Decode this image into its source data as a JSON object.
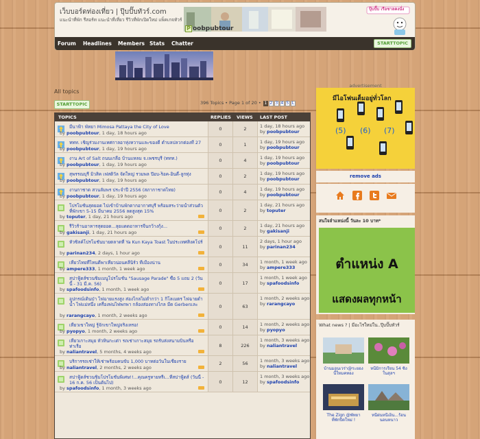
{
  "header": {
    "site_title": "เว็บบอร์ดท่องเที่ยว | ปุ๊บปั๊บทัวร์.com",
    "tagline": "แนะนำที่พัก รีสอร์ท แนะนำที่เที่ยว รีวิวที่พักเปิดใหม่ แพ็คเกจทัวร์",
    "logo_mark": "P",
    "logo_text": "oobpubtour",
    "sticker_text": "ปุ๊บปั๊บ เรือชาลคงนั่ง"
  },
  "nav": {
    "items": [
      "Forum",
      "Headlines",
      "Members",
      "Stats",
      "Chatter"
    ],
    "start_topic_a": "START",
    "start_topic_b": "TOPIC"
  },
  "main": {
    "heading": "All topics",
    "start_topic_a": "START",
    "start_topic_b": "TOPIC",
    "pager_text": "396 Topics • Page 1 of 20 •",
    "pages": [
      "1",
      "2",
      "3",
      "4",
      "5",
      "L"
    ],
    "columns": {
      "topics": "TOPICS",
      "replies": "REPLIES",
      "views": "VIEWS",
      "last_post": "LAST POST"
    },
    "topics": [
      {
        "title": "มีนาฟ้า พัทยา Mimosa Pattaya the City of Love",
        "author": "poobpubtour",
        "age": "1 day, 18 hours ago",
        "replies": "0",
        "views": "2",
        "last_time": "1 day, 18 hours ago",
        "last_by": "poobpubtour",
        "pinned": true,
        "hot": false
      },
      {
        "title": "ททท. เชิญร่วมงานเทศกาลอาหุ่งหวานและของดี ตำบลปลวกต่องที่ 27",
        "author": "poobpubtour",
        "age": "1 day, 19 hours ago",
        "replies": "0",
        "views": "1",
        "last_time": "1 day, 19 hours ago",
        "last_by": "poobpubtour",
        "pinned": true,
        "hot": false
      },
      {
        "title": "งาน Art of Salt ถนนเกลือ บ้านแหลม จ.เพชรบุรี (ททท.)",
        "author": "poobpubtour",
        "age": "1 day, 19 hours ago",
        "replies": "0",
        "views": "4",
        "last_time": "1 day, 19 hours ago",
        "last_by": "poobpubtour",
        "pinned": true,
        "hot": false
      },
      {
        "title": "สุพรรณบุรี มิวสิค เฟสติวัล จัดใหญ่ รวมพล ป๊อบ-ร็อค-อินดี้-ลูกทุ่ง",
        "author": "poobpubtour",
        "age": "1 day, 19 hours ago",
        "replies": "0",
        "views": "2",
        "last_time": "1 day, 19 hours ago",
        "last_by": "poobpubtour",
        "pinned": true,
        "hot": false
      },
      {
        "title": "งานกาชาด สวนลัมพร ประจำปี 2556 (สภากาชาดไทย)",
        "author": "poobpubtour",
        "age": "1 day, 19 hours ago",
        "replies": "0",
        "views": "4",
        "last_time": "1 day, 19 hours ago",
        "last_by": "poobpubtour",
        "pinned": true,
        "hot": false
      },
      {
        "title": "โปรโมชั่นสุดยอด ไปเข้าบ้านพักตากอากาศบุรี พร้อมสระว่ายน้ำส่วนตัว ที่พักเขา 5-15 มีนาคม 2556 ลดสูงสุด 15%",
        "author": "toputer",
        "age": "1 day, 21 hours ago",
        "replies": "0",
        "views": "2",
        "last_time": "1 day, 21 hours ago",
        "last_by": "toputer",
        "pinned": false,
        "hot": true
      },
      {
        "title": "รีวิวร้านอาหารสุดยอด...ลุยแดดอาหารจีนกว้างกุ้ง...",
        "author": "gakisanji",
        "age": "1 day, 21 hours ago",
        "replies": "0",
        "views": "2",
        "last_time": "1 day, 21 hours ago",
        "last_by": "gakisanji",
        "pinned": false,
        "hot": true
      },
      {
        "title": "หัวซิลค์โปรโมชันบายตลาดที่ Ya Kun Kaya Toast ในประเทศสิงคโปร์",
        "author": "parinan234",
        "age": "2 days, 1 hour ago",
        "replies": "0",
        "views": "11",
        "last_time": "2 days, 1 hour ago",
        "last_by": "parinan234",
        "pinned": false,
        "hot": true
      },
      {
        "title": "เที่ยวไทยที่ไหนดีพาเที่ยวน่อนคลีนิร์ว ที่เมืองน่าน",
        "author": "ampere333",
        "age": "1 month, 1 week ago",
        "replies": "0",
        "views": "34",
        "last_time": "1 month, 1 week ago",
        "last_by": "ampere333",
        "pinned": false,
        "hot": true
      },
      {
        "title": "สปาฟู้ดส์ชวนชิมเมนูโปรโมชั่น \"Sausage Parade\" ซื้อ 5 แถม 2 (วันนี้ - 31 มี.ค. 56)",
        "author": "spafoodsinfo",
        "age": "1 month, 1 week ago",
        "replies": "0",
        "views": "17",
        "last_time": "1 month, 1 week ago",
        "last_by": "spafoodsinfo",
        "pinned": false,
        "hot": true
      },
      {
        "title": "อุปกรณ์เดินป่า ไฟฉายแรงสูง ส่องไกลไม่ต่ำกว่า 1 กิโลเมตร ไฟฉายดำน้ำ ไฟแม่หนึ่ง เครื่องพ่นไฟพกพา กล้องส่องทางไกล มีด Gerberและไทยผลกกล้า",
        "author": "rarangcayo",
        "age": "1 month, 2 weeks ago",
        "replies": "0",
        "views": "63",
        "last_time": "1 month, 2 weeks ago",
        "last_by": "rarangcayo",
        "pinned": false,
        "hot": true
      },
      {
        "title": "เที่ยวเขาใหญ่ รู้จักเขาใหญ่จริงเหรอ!",
        "author": "pyopyo",
        "age": "1 month, 2 weeks ago",
        "replies": "0",
        "views": "14",
        "last_time": "1 month, 2 weeks ago",
        "last_by": "pyopyo",
        "pinned": false,
        "hot": true
      },
      {
        "title": "เที่ยวเกาะสมุย หัวหินกะเต่า รถเช่าเกาะสมุย รถรับส่งสนามบินหรือท่าเรือ",
        "author": "naliantravel",
        "age": "5 months, 4 weeks ago",
        "replies": "8",
        "views": "226",
        "last_time": "1 month, 3 weeks ago",
        "last_by": "naliantravel",
        "pinned": false,
        "hot": true
      },
      {
        "title": "บริการรถเช่าให้เช่าพร้อมคนขับ 1,000 บาทต่อวันในเชียงราย",
        "author": "naliantravel",
        "age": "2 months, 2 weeks ago",
        "replies": "2",
        "views": "56",
        "last_time": "1 month, 3 weeks ago",
        "last_by": "naliantravel",
        "pinned": false,
        "hot": true
      },
      {
        "title": "สปาฟู้ดส์ชวนชิมโปรโมชั่นพิเศษ!!...คุณครูหายหรีเ...ที่สปาฟู้ดส์ (วันนี้ - 16 ก.ค. 56 เป็นต้นไป)",
        "author": "spafoodsinfo",
        "age": "1 month, 3 weeks ago",
        "replies": "0",
        "views": "12",
        "last_time": "1 month, 3 weeks ago",
        "last_by": "spafoodsinfo",
        "pinned": false,
        "hot": true
      }
    ]
  },
  "sidebar": {
    "ad_label": "advertisement",
    "ad_headline": "มีไอโฟนเต็มอยู่ทั่วโลก",
    "ad_numbers": [
      "(5)",
      "(6)",
      "(7)"
    ],
    "remove_ads": "remove ads",
    "social_icons": [
      "home-icon",
      "facebook-icon",
      "twitter-icon",
      "mail-icon"
    ],
    "sponsor_title": "สนใจลำแหน่งนี้ วันละ 10 บาท*",
    "sponsor_line1": "ตำแหน่ง A",
    "sponsor_line2": "แสดงผลทุกหน้า",
    "news_title": "What news ? | มีอะไรใหม่ใน..ปุ๊บปั๊บทัวร์",
    "news": [
      {
        "caption": "บ้านมอนเวร่า@ระยองนี้ใหมคทอง"
      },
      {
        "caption": "หนีมิการเรียน 54 ซิ่งในสุลฯ"
      },
      {
        "caption": "The Zign @พัทยาที่พักปิดใหม่ !"
      },
      {
        "caption": "หนีฝนหนีเย็น...ร้อนนอนหนาว"
      }
    ]
  },
  "colors": {
    "nav_bg": "#3a332b",
    "link": "#1a3fae",
    "start_topic_green": "#4b9a2e",
    "table_header": "#4a4038",
    "ad_yellow": "#f5d13a",
    "sponsor_green": "#8bc34a"
  }
}
